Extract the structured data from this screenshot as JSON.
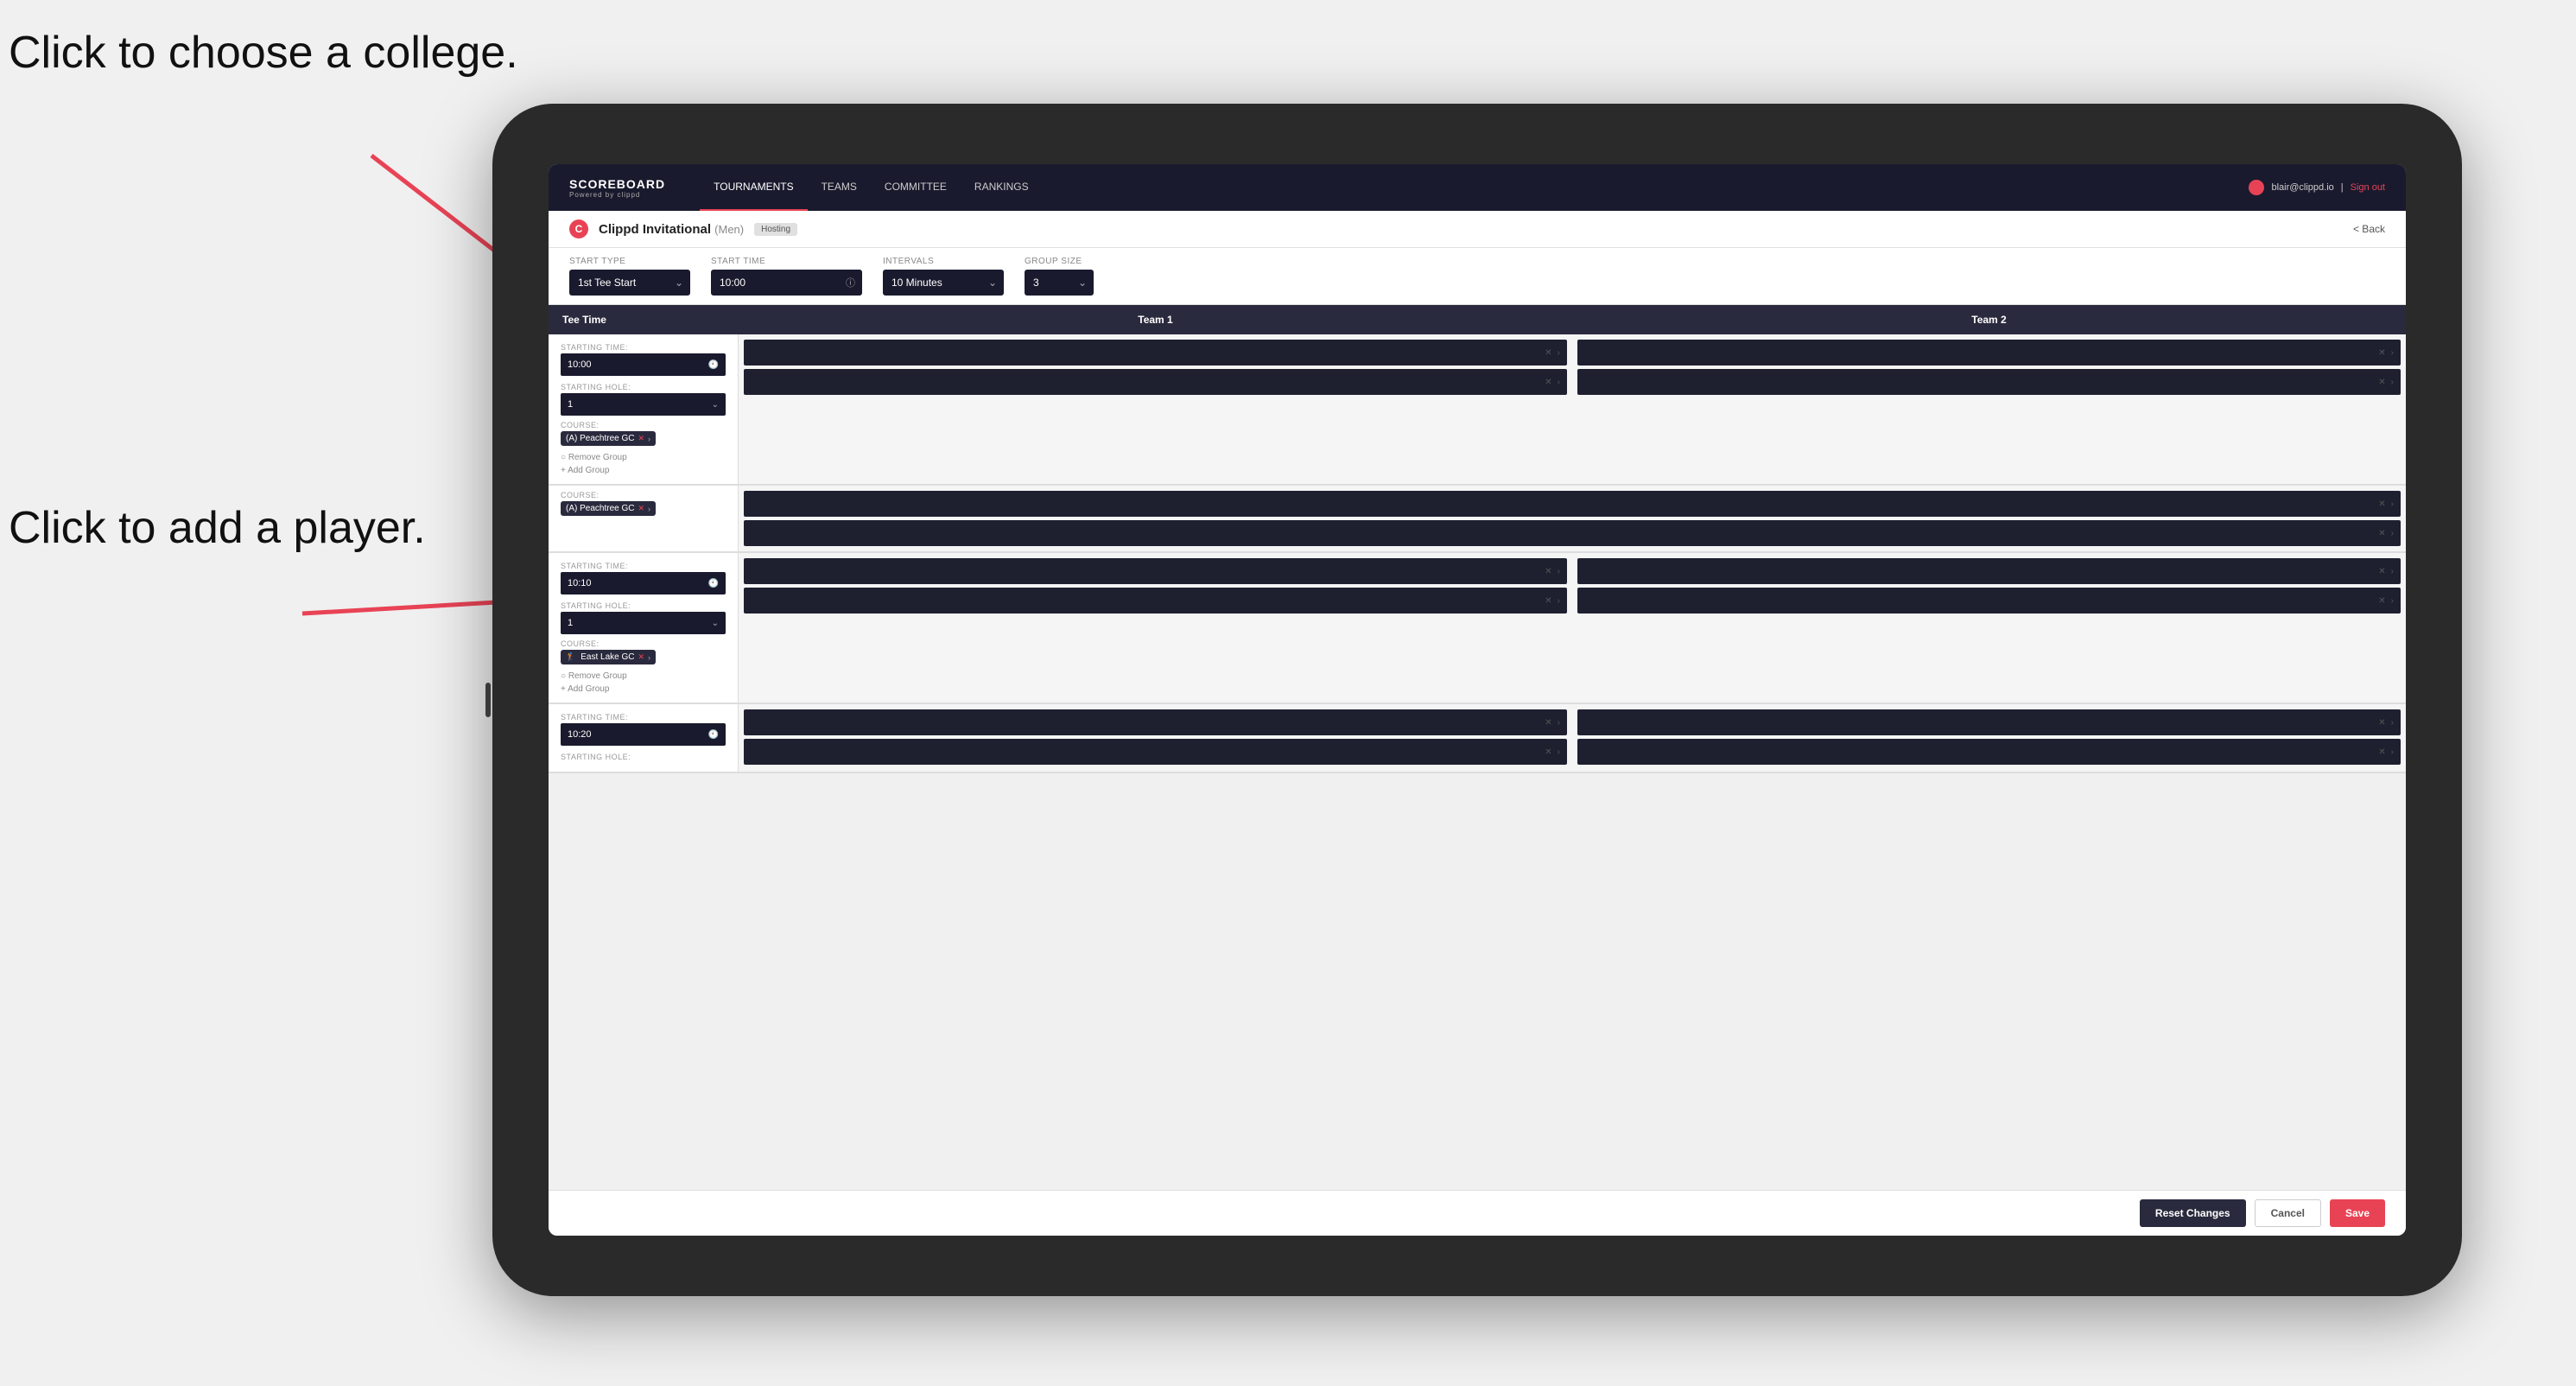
{
  "annotations": {
    "top_text": "Click to choose a college.",
    "bottom_text": "Click to add a player."
  },
  "nav": {
    "logo": "SCOREBOARD",
    "powered_by": "Powered by clippd",
    "tabs": [
      "TOURNAMENTS",
      "TEAMS",
      "COMMITTEE",
      "RANKINGS"
    ],
    "active_tab": "TOURNAMENTS",
    "user_email": "blair@clippd.io",
    "sign_out": "Sign out"
  },
  "page": {
    "tournament_name": "Clippd Invitational",
    "gender": "(Men)",
    "badge": "Hosting",
    "back_label": "< Back"
  },
  "controls": {
    "start_type_label": "Start Type",
    "start_type_value": "1st Tee Start",
    "start_time_label": "Start Time",
    "start_time_value": "10:00",
    "intervals_label": "Intervals",
    "intervals_value": "10 Minutes",
    "group_size_label": "Group Size",
    "group_size_value": "3"
  },
  "table": {
    "col1": "Tee Time",
    "col2": "Team 1",
    "col3": "Team 2"
  },
  "groups": [
    {
      "starting_time": "10:00",
      "starting_hole": "1",
      "course_label": "COURSE:",
      "course_tag": "(A) Peachtree GC",
      "remove_group": "Remove Group",
      "add_group": "+ Add Group",
      "team1_slots": 2,
      "team2_slots": 2
    },
    {
      "starting_time": "10:10",
      "starting_hole": "1",
      "course_label": "COURSE:",
      "course_tag": "East Lake GC",
      "remove_group": "Remove Group",
      "add_group": "+ Add Group",
      "team1_slots": 2,
      "team2_slots": 2
    },
    {
      "starting_time": "10:20",
      "starting_hole": "",
      "course_label": "",
      "course_tag": "",
      "remove_group": "",
      "add_group": "",
      "team1_slots": 2,
      "team2_slots": 2
    }
  ],
  "footer": {
    "reset_label": "Reset Changes",
    "cancel_label": "Cancel",
    "save_label": "Save"
  }
}
